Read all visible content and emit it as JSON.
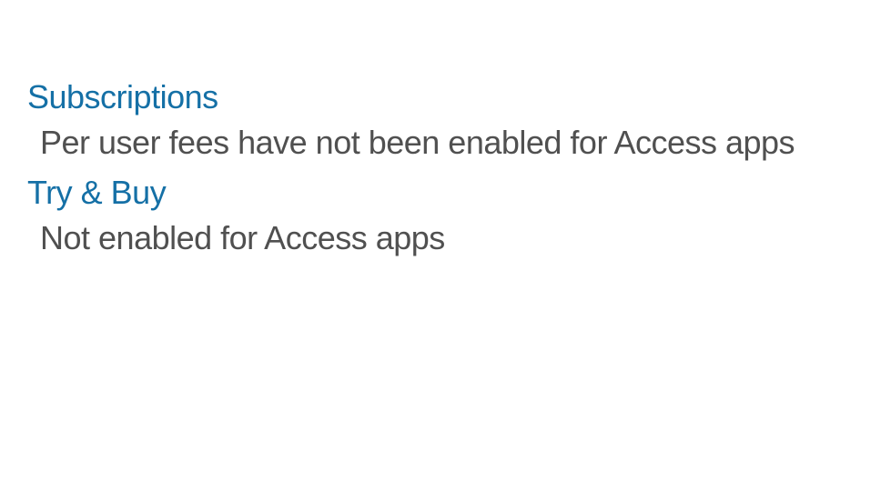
{
  "sections": [
    {
      "heading": "Subscriptions",
      "body": "Per user fees have not been enabled for Access apps"
    },
    {
      "heading": "Try & Buy",
      "body": "Not enabled for Access apps"
    }
  ]
}
